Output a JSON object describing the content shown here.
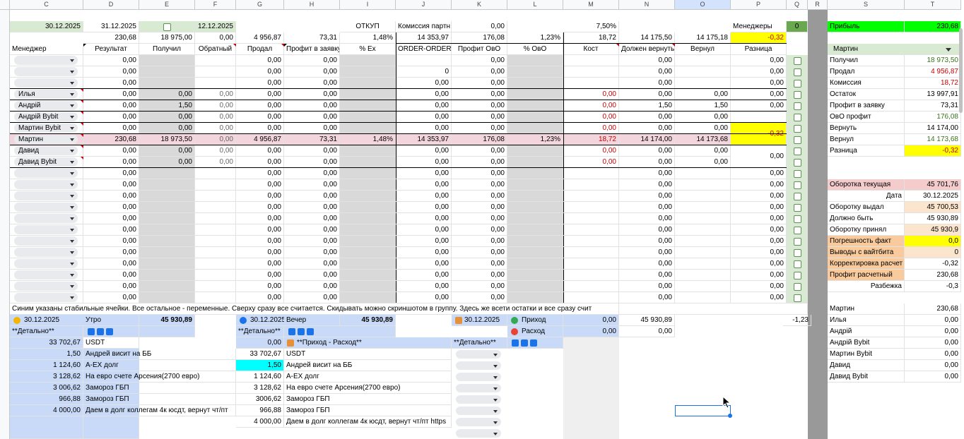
{
  "columns": [
    "C",
    "D",
    "E",
    "F",
    "G",
    "H",
    "I",
    "J",
    "K",
    "L",
    "M",
    "N",
    "O",
    "P",
    "Q",
    "R",
    "S",
    "T"
  ],
  "top": {
    "c2": "30.12.2025",
    "d2": "31.12.2025",
    "f2": "12.12.2025",
    "i2": "ОТКУП",
    "j2": "Комиссия партн",
    "k2": "0,00",
    "m2": "7,50%",
    "p2": "Менеджеры",
    "q2": "0",
    "s2": "Прибыль",
    "t2": "230,68"
  },
  "totals": {
    "d": "230,68",
    "e": "18 975,00",
    "f": "0,00",
    "g": "4 956,87",
    "h": "73,31",
    "i": "1,48%",
    "j": "14 353,97",
    "k": "176,08",
    "l": "1,23%",
    "m": "18,72",
    "n": "14 175,50",
    "o": "14 175,18",
    "p": "-0,32"
  },
  "headers": {
    "c": "Менеджер",
    "d": "Результат",
    "e": "Получил",
    "f": "Обратный",
    "g": "Продал",
    "h": "Профит в заявку",
    "i": "% Ex",
    "j": "ORDER-ORDER",
    "k": "Профит ОвО",
    "l": "% ОвО",
    "m": "Кост",
    "n": "Должен вернуть",
    "o": "Вернул",
    "p": "Разница"
  },
  "rows": [
    {
      "name": "",
      "d": "0,00",
      "g": "0,00",
      "h": "0,00",
      "k": "0,00",
      "n": "0,00",
      "p": "0,00"
    },
    {
      "name": "",
      "d": "0,00",
      "g": "0,00",
      "h": "0,00",
      "j": "0",
      "k": "0,00",
      "n": "0,00",
      "p": "0,00"
    },
    {
      "name": "",
      "d": "0,00",
      "g": "0,00",
      "h": "0,00",
      "j": "0,00",
      "k": "0,00",
      "n": "0,00",
      "p": "0,00"
    },
    {
      "name": "Илья",
      "d": "0,00",
      "e": "0,00",
      "f": "0,00",
      "g": "0,00",
      "h": "0,00",
      "j": "0,00",
      "k": "0,00",
      "m": "0,00",
      "n": "0,00",
      "o": "0,00",
      "p": "0,00"
    },
    {
      "name": "Андрій",
      "d": "0,00",
      "e": "1,50",
      "f": "0,00",
      "g": "0,00",
      "h": "0,00",
      "j": "0,00",
      "k": "0,00",
      "m": "0,00",
      "n": "1,50",
      "o": "1,50",
      "p": "0,00"
    },
    {
      "name": "Андрій Bybit",
      "d": "0,00",
      "e": "0,00",
      "f": "0,00",
      "g": "0,00",
      "h": "0,00",
      "j": "0,00",
      "k": "0,00",
      "m": "0,00",
      "n": "0,00",
      "o": "0,00"
    },
    {
      "name": "Мартин Bybit",
      "d": "0,00",
      "e": "0,00",
      "f": "0,00",
      "g": "0,00",
      "h": "0,00",
      "j": "0,00",
      "k": "0,00",
      "m": "0,00",
      "n": "0,00",
      "o": "0,00"
    },
    {
      "name": "Мартин",
      "d": "230,68",
      "e": "18 973,50",
      "f": "0,00",
      "g": "4 956,87",
      "h": "73,31",
      "i": "1,48%",
      "j": "14 353,97",
      "k": "176,08",
      "l": "1,23%",
      "m": "18,72",
      "n": "14 174,00",
      "o": "14 173,68"
    },
    {
      "name": "Давид",
      "d": "0,00",
      "e": "0,00",
      "f": "0,00",
      "g": "0,00",
      "h": "0,00",
      "j": "0,00",
      "k": "0,00",
      "m": "0,00",
      "n": "0,00",
      "o": "0,00"
    },
    {
      "name": "Давид Bybit",
      "d": "0,00",
      "e": "0,00",
      "f": "0,00",
      "g": "0,00",
      "h": "0,00",
      "j": "0,00",
      "k": "0,00",
      "m": "0,00",
      "n": "0,00",
      "o": "0,00"
    }
  ],
  "merged_p": {
    "martin": "-0,32",
    "david": "0,00"
  },
  "empty_row": {
    "d": "0,00",
    "g": "0,00",
    "h": "0,00",
    "j": "0,00",
    "k": "0,00",
    "n": "0,00",
    "p": "0,00"
  },
  "empty_row_count": 12,
  "note_line": "Синим указаны стабильные ячейки. Все остальное - переменные. Сверху сразу все считается. Скидывать можно скриншотом в группу. Здесь же всети остатки и все сразу счит",
  "bottom": {
    "morning": {
      "date": "30.12.2025",
      "label": "Утро",
      "total": "45 930,89"
    },
    "evening": {
      "date": "30.12.2025",
      "label": "Вечер",
      "total": "45 930,89"
    },
    "third": {
      "date": "30.12.2025"
    },
    "detail": "**Детально**",
    "incoming": "Приход",
    "outgoing": "Расход",
    "incoming_val": "0,00",
    "outgoing_val": "0,00",
    "n_val1": "45 930,89",
    "n_val2": "0,00",
    "q_val": "-1,23",
    "income_expense": "**Приход - Расход**",
    "left_items": [
      {
        "v": "33 702,67",
        "t": "USDT"
      },
      {
        "v": "1,50",
        "t": "Андрей висит на ББ"
      },
      {
        "v": "1 124,60",
        "t": "A-EX долг"
      },
      {
        "v": "3 128,62",
        "t": "На евро счете Арсения(2700 евро)"
      },
      {
        "v": "3 006,62",
        "t": "Замороз ГБП"
      },
      {
        "v": "966,88",
        "t": "Замороз ГБП"
      },
      {
        "v": "4 000,00",
        "t": "Даем в долг коллегам 4к юсдт, вернут чт/пт"
      }
    ],
    "mid_first": "0,00",
    "mid_items": [
      {
        "v": "33 702,67",
        "t": "USDT"
      },
      {
        "v": "1,50",
        "t": "Андрей висит на ББ"
      },
      {
        "v": "1 124,60",
        "t": "A-EX долг"
      },
      {
        "v": "3 128,62",
        "t": "На евро счете Арсения(2700 евро)"
      },
      {
        "v": "3006,62",
        "t": "Замороз ГБП"
      },
      {
        "v": "966,88",
        "t": "Замороз ГБП"
      },
      {
        "v": "4 000,00",
        "t": "Даем в долг коллегам 4к юсдт, вернут чт/пт https"
      }
    ]
  },
  "side": {
    "selector": "Мартин",
    "stats": [
      {
        "l": "Получил",
        "v": "18 973,50",
        "cls": "grn"
      },
      {
        "l": "Продал",
        "v": "4 956,87",
        "cls": "red"
      },
      {
        "l": "Комиссия",
        "v": "18,72",
        "cls": "red"
      },
      {
        "l": "Остаток",
        "v": "13 997,91",
        "cls": ""
      },
      {
        "l": "Профит в заявку",
        "v": "73,31",
        "cls": ""
      },
      {
        "l": "ОвО профит",
        "v": "176,08",
        "cls": "grn"
      },
      {
        "l": "Вернуть",
        "v": "14 174,00",
        "cls": ""
      },
      {
        "l": "Вернул",
        "v": "14 173,68",
        "cls": "grn"
      },
      {
        "l": "Разница",
        "v": "-0,32",
        "cls": "ylw"
      }
    ],
    "turnover": [
      {
        "l": "Оборотка текущая",
        "v": "45 701,76",
        "lc": "salmon",
        "vc": "salmon"
      },
      {
        "l": "Дата",
        "v": "30.12.2025",
        "lc": "",
        "vc": "",
        "lr": true
      },
      {
        "l": "Оборотку выдал",
        "v": "45 700,53",
        "lc": "",
        "vc": "peach"
      },
      {
        "l": "Должно быть",
        "v": "45 930,89",
        "lc": "",
        "vc": ""
      },
      {
        "l": "Оборотку принял",
        "v": "45 930,9",
        "lc": "",
        "vc": "peach"
      },
      {
        "l": "Погрешность факт",
        "v": "0,0",
        "lc": "orange",
        "vc": "yellow"
      },
      {
        "l": "Выводы с вайтбита",
        "v": "0",
        "lc": "orange",
        "vc": "peach"
      },
      {
        "l": "Корректировка расчет",
        "v": "-0,32",
        "lc": "orange",
        "vc": ""
      },
      {
        "l": "Профит расчетный",
        "v": "230,68",
        "lc": "orange",
        "vc": ""
      },
      {
        "l": "Разбежка",
        "v": "-0,3",
        "lc": "",
        "vc": "",
        "lr": true
      }
    ],
    "managers": [
      {
        "l": "Мартин",
        "v": "230,68"
      },
      {
        "l": "Илья",
        "v": "0,00"
      },
      {
        "l": "Андрій",
        "v": "0,00"
      },
      {
        "l": "Андрій Bybit",
        "v": "0,00"
      },
      {
        "l": "Мартин Bybit",
        "v": "0,00"
      },
      {
        "l": "Давид",
        "v": "0,00"
      },
      {
        "l": "Давид Bybit",
        "v": "0,00"
      }
    ]
  }
}
